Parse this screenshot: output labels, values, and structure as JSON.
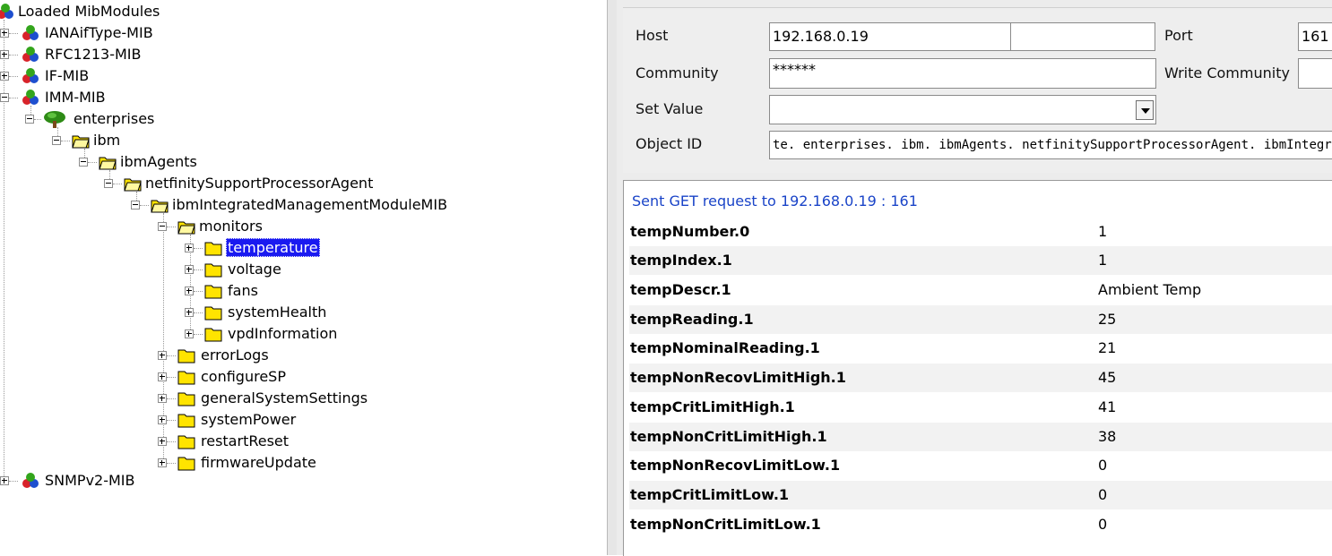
{
  "tree": {
    "root": "Loaded MibModules",
    "modules": [
      "IANAifType-MIB",
      "RFC1213-MIB",
      "IF-MIB",
      "IMM-MIB",
      "SNMPv2-MIB"
    ],
    "enterprises": "enterprises",
    "ibm": "ibm",
    "ibmAgents": "ibmAgents",
    "netfinity": "netfinitySupportProcessorAgent",
    "immMib": "ibmIntegratedManagementModuleMIB",
    "monitors": "monitors",
    "monitorChildren": [
      "temperature",
      "voltage",
      "fans",
      "systemHealth",
      "vpdInformation"
    ],
    "siblings": [
      "errorLogs",
      "configureSP",
      "generalSystemSettings",
      "systemPower",
      "restartReset",
      "firmwareUpdate"
    ],
    "selected": "temperature"
  },
  "form": {
    "host_label": "Host",
    "host_value": "192.168.0.19",
    "port_label": "Port",
    "port_value": "161",
    "community_label": "Community",
    "community_value": "******",
    "write_community_label": "Write Community",
    "write_community_value": "",
    "set_value_label": "Set Value",
    "set_value_value": "",
    "object_id_label": "Object ID",
    "object_id_value": "te. enterprises. ibm. ibmAgents. netfinitySupportProcessorAgent. ibmIntegra"
  },
  "results": {
    "status": "Sent GET request to 192.168.0.19 : 161",
    "rows": [
      {
        "name": "tempNumber.0",
        "value": "1"
      },
      {
        "name": "tempIndex.1",
        "value": "1"
      },
      {
        "name": "tempDescr.1",
        "value": "Ambient Temp"
      },
      {
        "name": "tempReading.1",
        "value": "25"
      },
      {
        "name": "tempNominalReading.1",
        "value": "21"
      },
      {
        "name": "tempNonRecovLimitHigh.1",
        "value": "45"
      },
      {
        "name": "tempCritLimitHigh.1",
        "value": "41"
      },
      {
        "name": "tempNonCritLimitHigh.1",
        "value": "38"
      },
      {
        "name": "tempNonRecovLimitLow.1",
        "value": "0"
      },
      {
        "name": "tempCritLimitLow.1",
        "value": "0"
      },
      {
        "name": "tempNonCritLimitLow.1",
        "value": "0"
      }
    ]
  },
  "colors": {
    "selection": "#1a1af0",
    "status_text": "#1a44c8",
    "folder": "#ffe400",
    "tree_green": "#2e8b16"
  },
  "icons": {
    "module": "mib-module-icon",
    "folder_closed": "folder-icon",
    "folder_open": "folder-open-icon",
    "enterprise": "tree-icon"
  }
}
